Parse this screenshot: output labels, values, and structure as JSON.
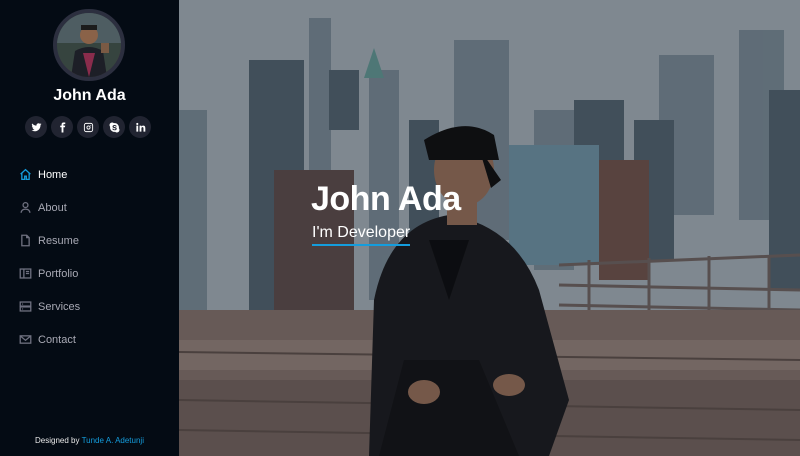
{
  "profile": {
    "name": "John Ada",
    "avatar_icon": "profile-photo"
  },
  "social": [
    {
      "icon": "twitter-icon"
    },
    {
      "icon": "facebook-icon"
    },
    {
      "icon": "instagram-icon"
    },
    {
      "icon": "skype-icon"
    },
    {
      "icon": "linkedin-icon"
    }
  ],
  "nav": {
    "items": [
      {
        "label": "Home",
        "icon": "home-icon",
        "active": true
      },
      {
        "label": "About",
        "icon": "user-icon"
      },
      {
        "label": "Resume",
        "icon": "file-icon"
      },
      {
        "label": "Portfolio",
        "icon": "book-icon"
      },
      {
        "label": "Services",
        "icon": "server-icon"
      },
      {
        "label": "Contact",
        "icon": "envelope-icon"
      }
    ]
  },
  "footer": {
    "prefix": "Designed by ",
    "author": "Tunde A. Adetunji"
  },
  "hero": {
    "title": "John Ada",
    "subtitle": "I'm Developer"
  },
  "colors": {
    "accent": "#149ddd",
    "sidebar_bg": "#040b14",
    "social_bg": "#212431"
  }
}
